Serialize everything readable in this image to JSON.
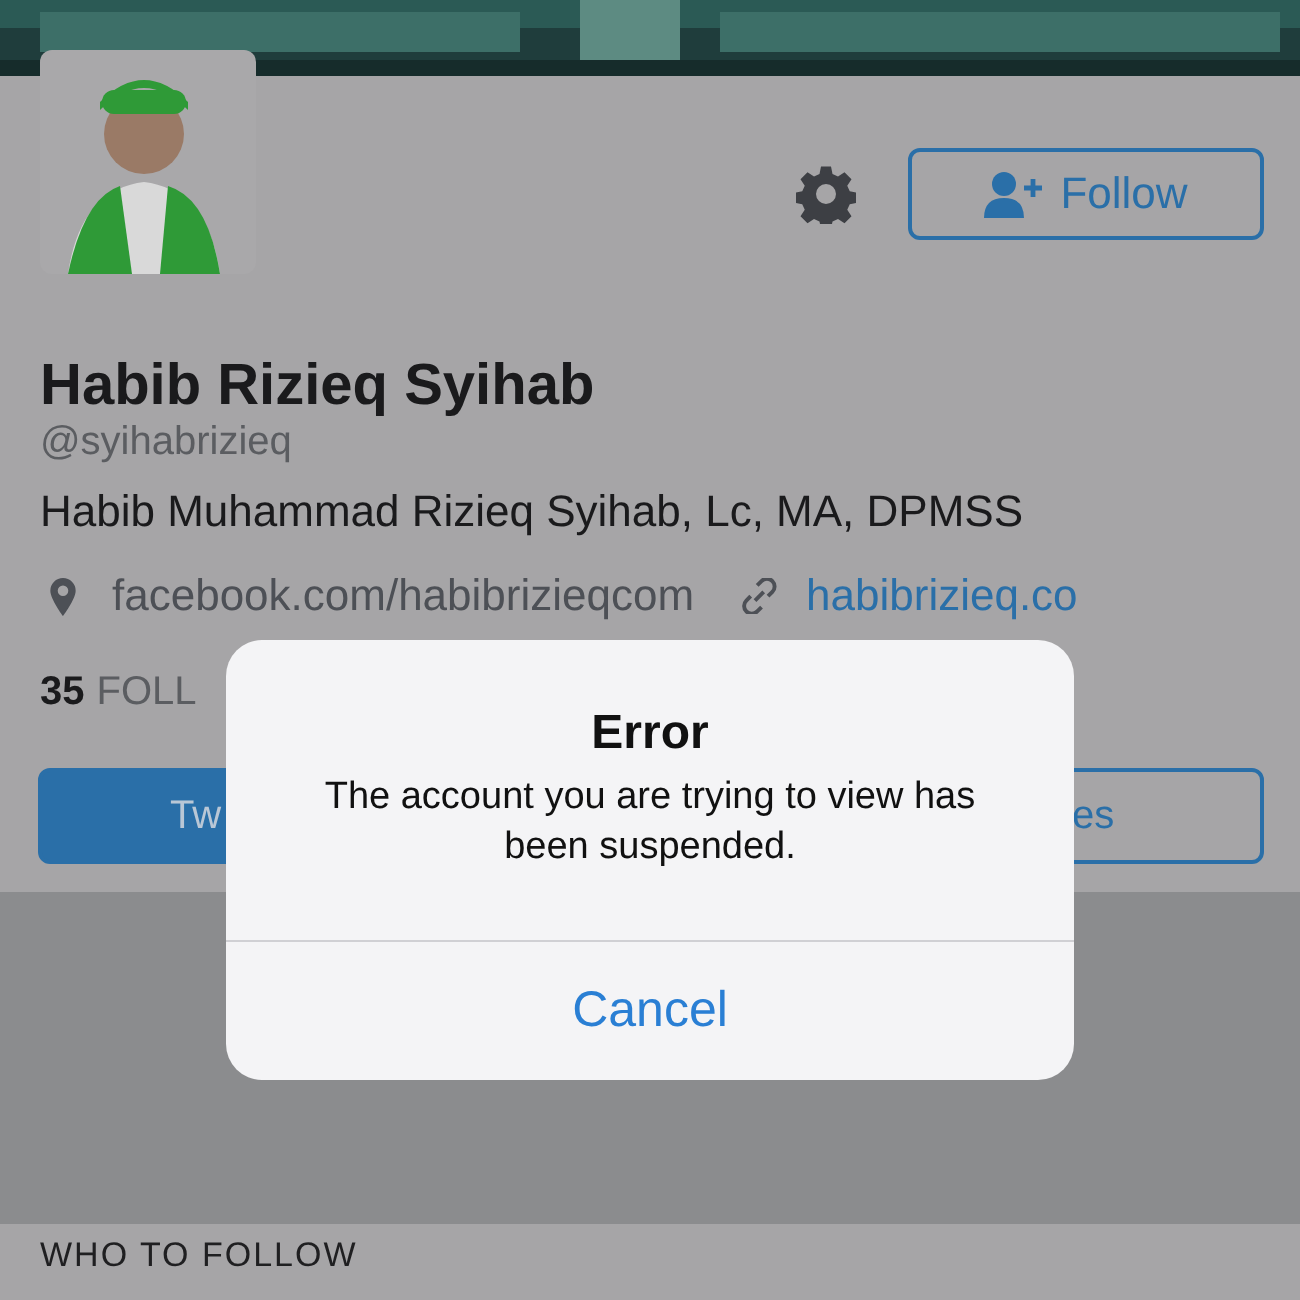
{
  "follow_button": {
    "label": "Follow"
  },
  "profile": {
    "name": "Habib Rizieq Syihab",
    "handle": "@syihabrizieq",
    "bio": "Habib Muhammad Rizieq Syihab, Lc, MA, DPMSS",
    "location": "facebook.com/habibrizieqcom",
    "website": "habibrizieq.co"
  },
  "stats": {
    "count": "35",
    "label": "FOLL"
  },
  "tabs": [
    {
      "label": "Tw",
      "selected": true
    },
    {
      "label": "es",
      "selected": false
    }
  ],
  "section_title": "WHO TO FOLLOW",
  "dialog": {
    "title": "Error",
    "message": "The account you are trying to view has been suspended.",
    "button": "Cancel"
  }
}
